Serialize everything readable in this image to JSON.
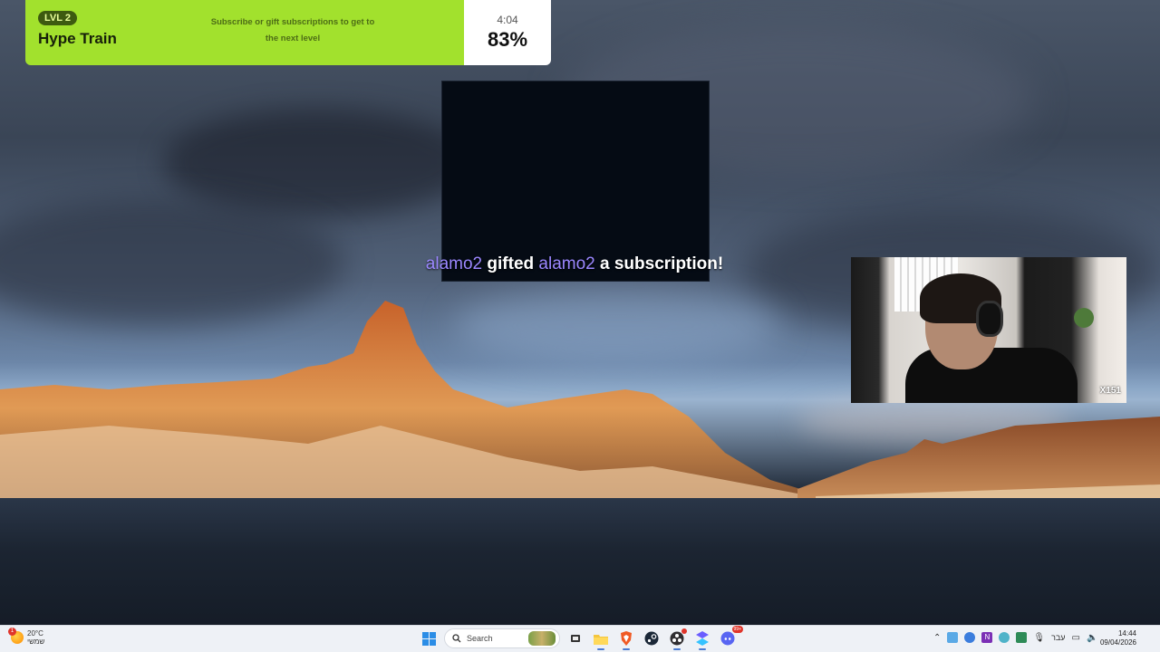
{
  "hype_train": {
    "level": "LVL 2",
    "title": "Hype Train",
    "subtitle": "Subscribe or gift subscriptions to get to the next level",
    "time_left": "4:04",
    "progress_text": "83%",
    "progress": 0.83
  },
  "alert": {
    "gifter": "alamo2",
    "verb": "gifted",
    "recipient": "alamo2",
    "suffix": "a subscription!"
  },
  "webcam": {
    "label": "X151"
  },
  "taskbar": {
    "weather": {
      "badge": "1",
      "temperature": "20°C",
      "condition": "שמשי"
    },
    "search_label": "Search",
    "language": "עבר",
    "time": "14:44",
    "date": "09/04/2026",
    "discord_badge": "99+"
  },
  "colors": {
    "hype_green": "#a2e12d",
    "alert_user": "#9b87ff",
    "taskbar_bg": "#eef1f6"
  }
}
